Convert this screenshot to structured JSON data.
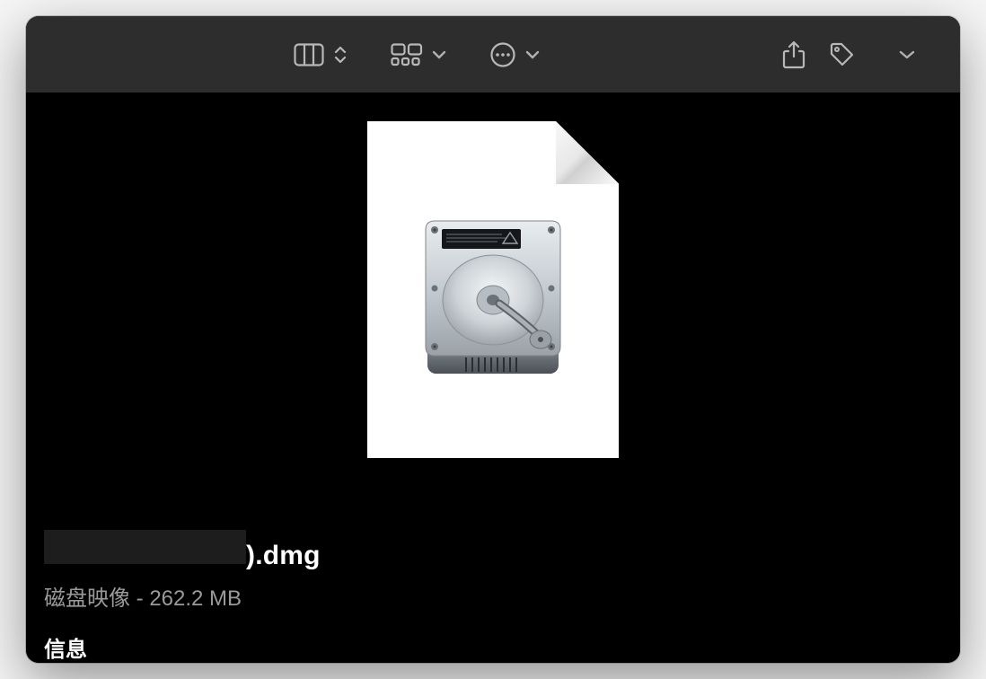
{
  "toolbar": {
    "icons": {
      "columns": "columns-view-icon",
      "gallery": "gallery-view-icon",
      "actions": "actions-menu-icon",
      "share": "share-icon",
      "tags": "tags-icon",
      "expand": "expand-icon"
    }
  },
  "file": {
    "name_visible_suffix": ").dmg",
    "kind": "磁盘映像",
    "separator": " - ",
    "size": "262.2 MB"
  },
  "labels": {
    "info_header": "信息"
  }
}
